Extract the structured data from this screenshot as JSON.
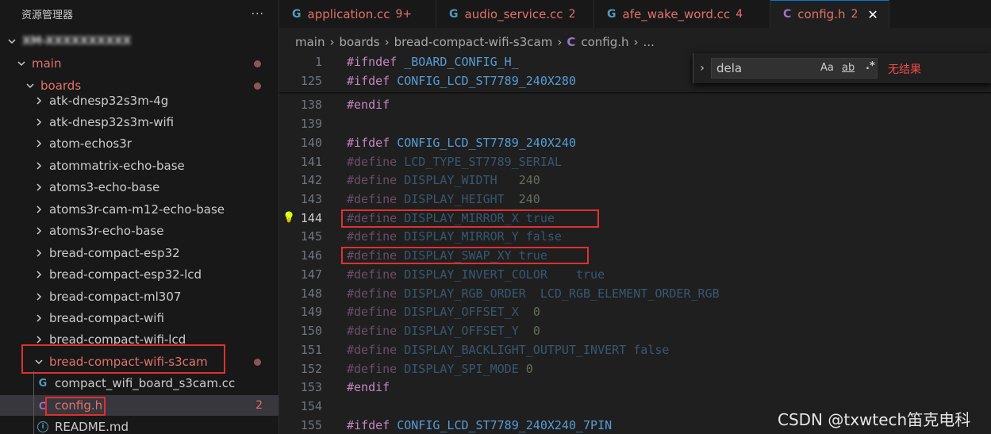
{
  "explorer": {
    "title": "资源管理器",
    "more": "···",
    "root": "XM-XXXXXXXXXX",
    "items": [
      {
        "label": "main",
        "chevron": "down",
        "modified": true,
        "dot": true
      },
      {
        "label": "boards",
        "chevron": "down",
        "modified": true,
        "dot": true
      },
      {
        "label": "atk-dnesp32s3m-4g",
        "chevron": "right"
      },
      {
        "label": "atk-dnesp32s3m-wifi",
        "chevron": "right"
      },
      {
        "label": "atom-echos3r",
        "chevron": "right"
      },
      {
        "label": "atommatrix-echo-base",
        "chevron": "right"
      },
      {
        "label": "atoms3-echo-base",
        "chevron": "right"
      },
      {
        "label": "atoms3r-cam-m12-echo-base",
        "chevron": "right"
      },
      {
        "label": "atoms3r-echo-base",
        "chevron": "right"
      },
      {
        "label": "bread-compact-esp32",
        "chevron": "right"
      },
      {
        "label": "bread-compact-esp32-lcd",
        "chevron": "right"
      },
      {
        "label": "bread-compact-ml307",
        "chevron": "right"
      },
      {
        "label": "bread-compact-wifi",
        "chevron": "right"
      },
      {
        "label": "bread-compact-wifi-lcd",
        "chevron": "right"
      },
      {
        "label": "bread-compact-wifi-s3cam",
        "chevron": "down",
        "modified": true,
        "dot": true
      },
      {
        "label": "compact_wifi_board_s3cam.cc",
        "icon": "cpp-file-icon"
      },
      {
        "label": "config.h",
        "icon": "c-header-file-icon",
        "badge": "2",
        "modified": true
      },
      {
        "label": "README.md",
        "icon": "info-file-icon"
      }
    ]
  },
  "tabs": [
    {
      "label": "application.cc",
      "badge": "9+",
      "icon": "cpp-file-icon",
      "modified": true
    },
    {
      "label": "audio_service.cc",
      "badge": "2",
      "icon": "cpp-file-icon",
      "modified": true
    },
    {
      "label": "afe_wake_word.cc",
      "badge": "4",
      "icon": "cpp-file-icon",
      "modified": true
    },
    {
      "label": "config.h",
      "badge": "2",
      "icon": "c-header-file-icon",
      "modified": true,
      "active": true,
      "close": "✕"
    }
  ],
  "breadcrumb": [
    "main",
    "boards",
    "bread-compact-wifi-s3cam",
    "config.h",
    "..."
  ],
  "find": {
    "query": "dela",
    "match_case": "Aa",
    "whole_word": "ab",
    "regex": ".*",
    "status": "无结果"
  },
  "editor": {
    "current_line": 144,
    "lines": [
      {
        "num": "1",
        "tokens": [
          [
            "#ifndef ",
            "kw"
          ],
          [
            "_BOARD_CONFIG_H_",
            "macro"
          ]
        ]
      },
      {
        "num": "125",
        "tokens": [
          [
            "#ifdef ",
            "kw"
          ],
          [
            "CONFIG_LCD_ST7789_240X280",
            "macro"
          ]
        ]
      },
      {
        "num": "138",
        "tokens": [
          [
            "#endif",
            "kw"
          ]
        ]
      },
      {
        "num": "139",
        "tokens": []
      },
      {
        "num": "140",
        "tokens": [
          [
            "#ifdef ",
            "kw"
          ],
          [
            "CONFIG_LCD_ST7789_240X240",
            "macro"
          ]
        ]
      },
      {
        "num": "141",
        "dim": true,
        "tokens": [
          [
            "#define ",
            "kw"
          ],
          [
            "LCD_TYPE_ST7789_SERIAL",
            "macro"
          ]
        ]
      },
      {
        "num": "142",
        "dim": true,
        "tokens": [
          [
            "#define ",
            "kw"
          ],
          [
            "DISPLAY_WIDTH   ",
            "macro"
          ],
          [
            "240",
            "num"
          ]
        ]
      },
      {
        "num": "143",
        "dim": true,
        "tokens": [
          [
            "#define ",
            "kw"
          ],
          [
            "DISPLAY_HEIGHT  ",
            "macro"
          ],
          [
            "240",
            "num"
          ]
        ]
      },
      {
        "num": "144",
        "dim": true,
        "tokens": [
          [
            "#define ",
            "kw"
          ],
          [
            "DISPLAY_MIRROR_X ",
            "macro"
          ],
          [
            "true",
            "bool"
          ]
        ]
      },
      {
        "num": "145",
        "dim": true,
        "tokens": [
          [
            "#define ",
            "kw"
          ],
          [
            "DISPLAY_MIRROR_Y ",
            "macro"
          ],
          [
            "false",
            "bool"
          ]
        ]
      },
      {
        "num": "146",
        "dim": true,
        "tokens": [
          [
            "#define ",
            "kw"
          ],
          [
            "DISPLAY_SWAP_XY ",
            "macro"
          ],
          [
            "true",
            "bool"
          ]
        ]
      },
      {
        "num": "147",
        "dim": true,
        "tokens": [
          [
            "#define ",
            "kw"
          ],
          [
            "DISPLAY_INVERT_COLOR    ",
            "macro"
          ],
          [
            "true",
            "bool"
          ]
        ]
      },
      {
        "num": "148",
        "dim": true,
        "tokens": [
          [
            "#define ",
            "kw"
          ],
          [
            "DISPLAY_RGB_ORDER  LCD_RGB_ELEMENT_ORDER_RGB",
            "macro"
          ]
        ]
      },
      {
        "num": "149",
        "dim": true,
        "tokens": [
          [
            "#define ",
            "kw"
          ],
          [
            "DISPLAY_OFFSET_X  ",
            "macro"
          ],
          [
            "0",
            "num"
          ]
        ]
      },
      {
        "num": "150",
        "dim": true,
        "tokens": [
          [
            "#define ",
            "kw"
          ],
          [
            "DISPLAY_OFFSET_Y  ",
            "macro"
          ],
          [
            "0",
            "num"
          ]
        ]
      },
      {
        "num": "151",
        "dim": true,
        "tokens": [
          [
            "#define ",
            "kw"
          ],
          [
            "DISPLAY_BACKLIGHT_OUTPUT_INVERT ",
            "macro"
          ],
          [
            "false",
            "bool"
          ]
        ]
      },
      {
        "num": "152",
        "dim": true,
        "tokens": [
          [
            "#define ",
            "kw"
          ],
          [
            "DISPLAY_SPI_MODE ",
            "macro"
          ],
          [
            "0",
            "num"
          ]
        ]
      },
      {
        "num": "153",
        "tokens": [
          [
            "#endif",
            "kw"
          ]
        ]
      },
      {
        "num": "154",
        "tokens": []
      },
      {
        "num": "155",
        "tokens": [
          [
            "#ifdef ",
            "kw"
          ],
          [
            "CONFIG_LCD_ST7789_240X240_7PIN",
            "macro"
          ]
        ]
      }
    ]
  },
  "watermark": "CSDN @txwtech笛克电科",
  "colors": {
    "modified": "#e2716b",
    "keyword": "#c586c0",
    "macro": "#569cd6",
    "number": "#b5cea8",
    "highlight_box": "#e03030",
    "find_no_results": "#f14c4c"
  }
}
